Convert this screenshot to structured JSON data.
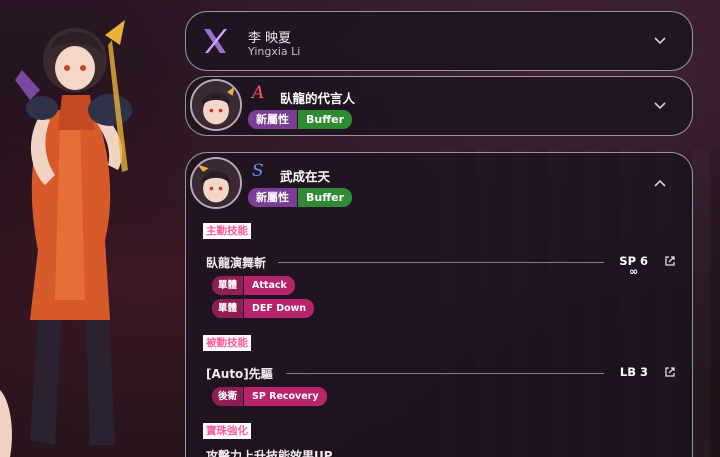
{
  "character": {
    "name_cn": "李 映夏",
    "name_en": "Yingxia Li",
    "logo_icon": "x-logo-icon"
  },
  "styles": [
    {
      "rank": "A",
      "rank_color": "#ff5566",
      "title": "臥龍的代言人",
      "attribute": "新屬性",
      "role": "Buffer",
      "expanded": false
    },
    {
      "rank": "S",
      "rank_color": "#6f8cff",
      "title": "武成在天",
      "attribute": "新屬性",
      "role": "Buffer",
      "expanded": true,
      "sections": {
        "active_label": "主動技能",
        "active_skill": {
          "name": "臥龍演舞斬",
          "cost": "SP 6",
          "cost_sub": "∞",
          "effects": [
            {
              "target": "單體",
              "effect": "Attack"
            },
            {
              "target": "單體",
              "effect": "DEF Down"
            }
          ]
        },
        "passive_label": "被動技能",
        "passive_skill": {
          "name": "[Auto]先驅",
          "cost": "LB 3",
          "effects": [
            {
              "target": "後衛",
              "effect": "SP Recovery"
            }
          ]
        },
        "jewel_label": "寶珠強化",
        "jewel_skill": {
          "name": "攻擊力上升技能效果UP"
        }
      }
    }
  ],
  "icons": {
    "collapse": "chevron-down-icon",
    "expand": "chevron-up-icon",
    "external": "external-link-icon"
  },
  "colors": {
    "accent_pink": "#ff5f9e",
    "attribute_purple": "#7a3e95",
    "role_green": "#2f8a34",
    "effect_dark": "#8e1f55",
    "effect_light": "#b8246b"
  }
}
